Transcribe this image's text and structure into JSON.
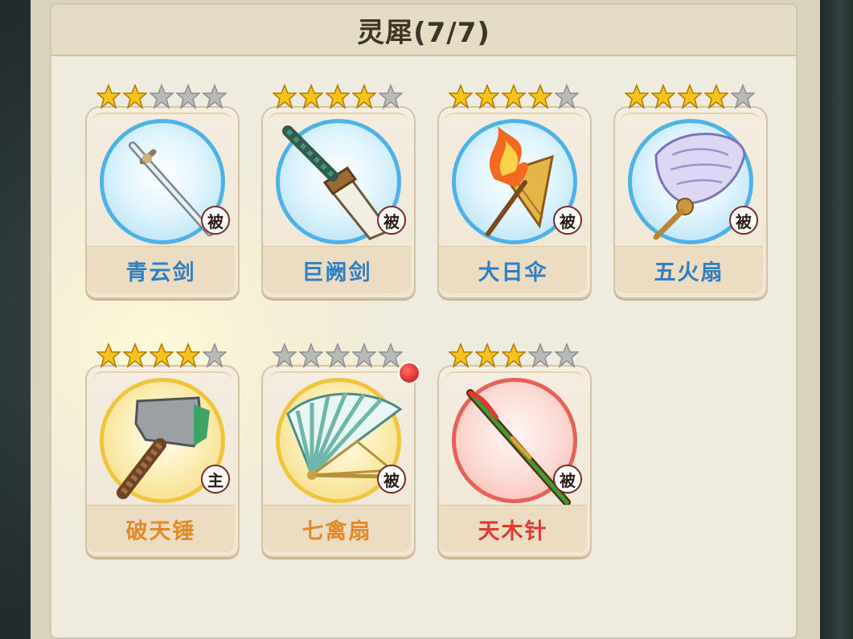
{
  "header": {
    "title": "灵犀(7/7)"
  },
  "colors": {
    "star_gold": "#f7c21a",
    "star_gray": "#b8b9b9",
    "ring_blue": "#4fb2e6",
    "ring_gold": "#f0c43d",
    "ring_red": "#e9605a",
    "name_blue": "#2f7fc1",
    "name_orange": "#e08a2a",
    "name_red": "#e0392f",
    "notification": "#d92a25"
  },
  "cards": [
    {
      "name": "青云剑",
      "stars": 2,
      "max_stars": 5,
      "badge": "被",
      "ring": "blue",
      "icon": "sword-icon"
    },
    {
      "name": "巨阙剑",
      "stars": 4,
      "max_stars": 5,
      "badge": "被",
      "ring": "blue",
      "icon": "great-sword-icon"
    },
    {
      "name": "大日伞",
      "stars": 4,
      "max_stars": 5,
      "badge": "被",
      "ring": "blue",
      "icon": "flaming-umbrella-icon"
    },
    {
      "name": "五火扇",
      "stars": 4,
      "max_stars": 5,
      "badge": "被",
      "ring": "blue",
      "icon": "feather-fan-icon"
    },
    {
      "name": "破天锤",
      "stars": 4,
      "max_stars": 5,
      "badge": "主",
      "ring": "gold",
      "icon": "hammer-icon"
    },
    {
      "name": "七禽扇",
      "stars": 0,
      "max_stars": 5,
      "badge": "被",
      "ring": "gold",
      "icon": "folding-fan-icon",
      "notification": true
    },
    {
      "name": "天木针",
      "stars": 3,
      "max_stars": 5,
      "badge": "被",
      "ring": "red",
      "icon": "needle-icon"
    }
  ]
}
